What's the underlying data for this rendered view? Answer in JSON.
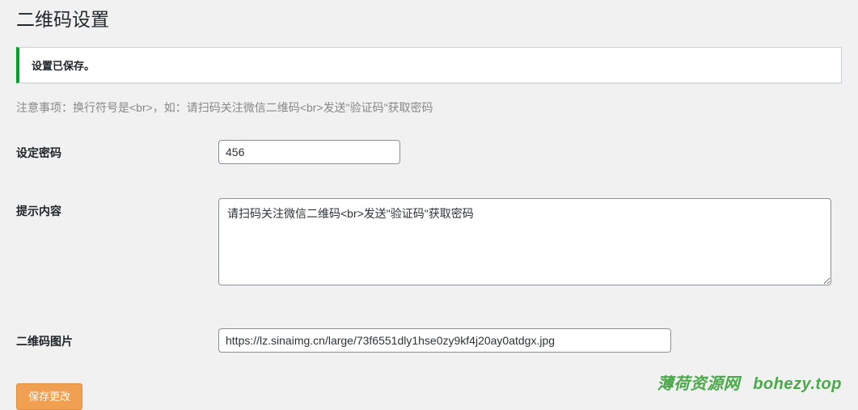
{
  "page": {
    "title": "二维码设置"
  },
  "notice": {
    "message": "设置已保存。"
  },
  "note": "注意事项：换行符号是<br>，如：请扫码关注微信二维码<br>发送\"验证码\"获取密码",
  "form": {
    "password": {
      "label": "设定密码",
      "value": "456"
    },
    "hint": {
      "label": "提示内容",
      "value": "请扫码关注微信二维码<br>发送\"验证码\"获取密码"
    },
    "qrimage": {
      "label": "二维码图片",
      "value": "https://lz.sinaimg.cn/large/73f6551dly1hse0zy9kf4j20ay0atdgx.jpg"
    },
    "submit": "保存更改"
  },
  "watermark": {
    "site": "薄荷资源网",
    "domain": "bohezy.top"
  }
}
